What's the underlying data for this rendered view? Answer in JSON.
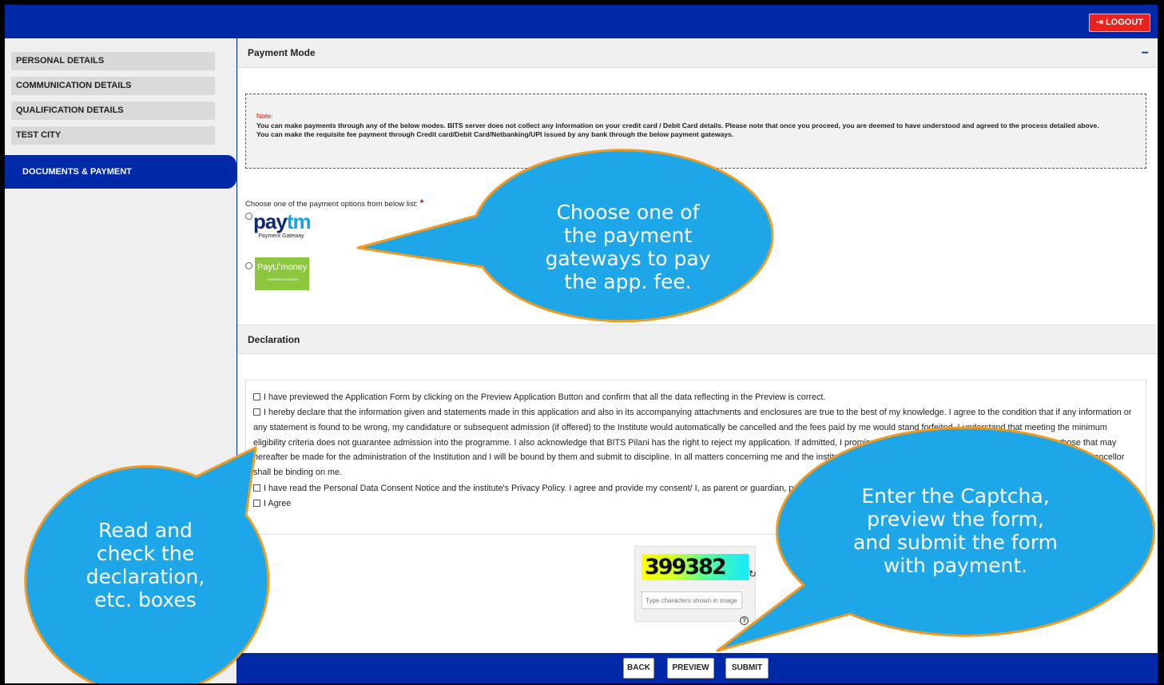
{
  "header": {
    "logout_label": "LOGOUT",
    "logout_icon": "sign-out-icon"
  },
  "sidebar": {
    "items": [
      {
        "label": "PERSONAL DETAILS"
      },
      {
        "label": "COMMUNICATION DETAILS"
      },
      {
        "label": "QUALIFICATION DETAILS"
      },
      {
        "label": "TEST CITY"
      }
    ],
    "active": "DOCUMENTS & PAYMENT"
  },
  "payment": {
    "title": "Payment Mode",
    "collapse_symbol": "−",
    "note_title": "Note:",
    "note_line1": "You can make payments through any of the below modes. BITS server does not collect any information on your credit card / Debit Card details. Please note that once you proceed, you are deemed to have understood and agreed to the process detailed above.",
    "note_line2": "You can make the requisite fee payment through Credit card/Debit Card/Netbanking/UPI issued by any bank through the below payment gateways.",
    "choose_label": "Choose one of the payment options from below list:",
    "required_mark": "*",
    "paytm_logo": "paytm",
    "paytm_sub": "Payment Gateway",
    "payu_logo": "PayUmoney",
    "payu_sub": "PAYMENT GATEWAY"
  },
  "declaration": {
    "title": "Declaration",
    "items": [
      "I have previewed the Application Form by clicking on the Preview Application Button and confirm that all the data reflecting in the Preview is correct.",
      "I hereby declare that the information given and statements made in this application and also in its accompanying attachments and enclosures are true to the best of my knowledge. I agree to the condition that if any information or any statement is found to be wrong, my candidature or subsequent admission (if offered) to the Institute would automatically be cancelled and the fees paid by me would stand forfeited. I understand that meeting the minimum eligibility criteria does not guarantee admission into the programme. I also acknowledge that BITS Pilani has the right to reject my application. If admitted, I promise to abide by the rules and regulations in force or those that may hereafter be made for the administration of the Institution and I will be bound by them and submit to discipline. In all matters concerning me and the institution, its hostel, Practice School stations, the decision of the Vice-chancellor shall be binding on me.",
      "I have read the Personal Data Consent Notice and the institute's Privacy Policy. I agree and provide my consent/ I, as parent or guardian, provide consent.",
      "I Agree"
    ]
  },
  "captcha": {
    "value": "399382",
    "input_placeholder": "Type characters shown in image",
    "help_symbol": "?"
  },
  "footer": {
    "back": "BACK",
    "preview": "PREVIEW",
    "submit": "SUBMIT"
  },
  "callouts": {
    "payment": [
      "Choose one of",
      "the payment",
      "gateways to pay",
      "the app. fee."
    ],
    "declaration": [
      "Read and",
      "check the",
      "declaration,",
      "etc. boxes"
    ],
    "submit": [
      "Enter the Captcha,",
      "preview the form,",
      "and submit the form",
      "with payment."
    ]
  },
  "colors": {
    "primary": "#0029a8",
    "logout": "#e8231e",
    "callout": "#1ea7e8",
    "callout_border": "#f39a1e"
  }
}
